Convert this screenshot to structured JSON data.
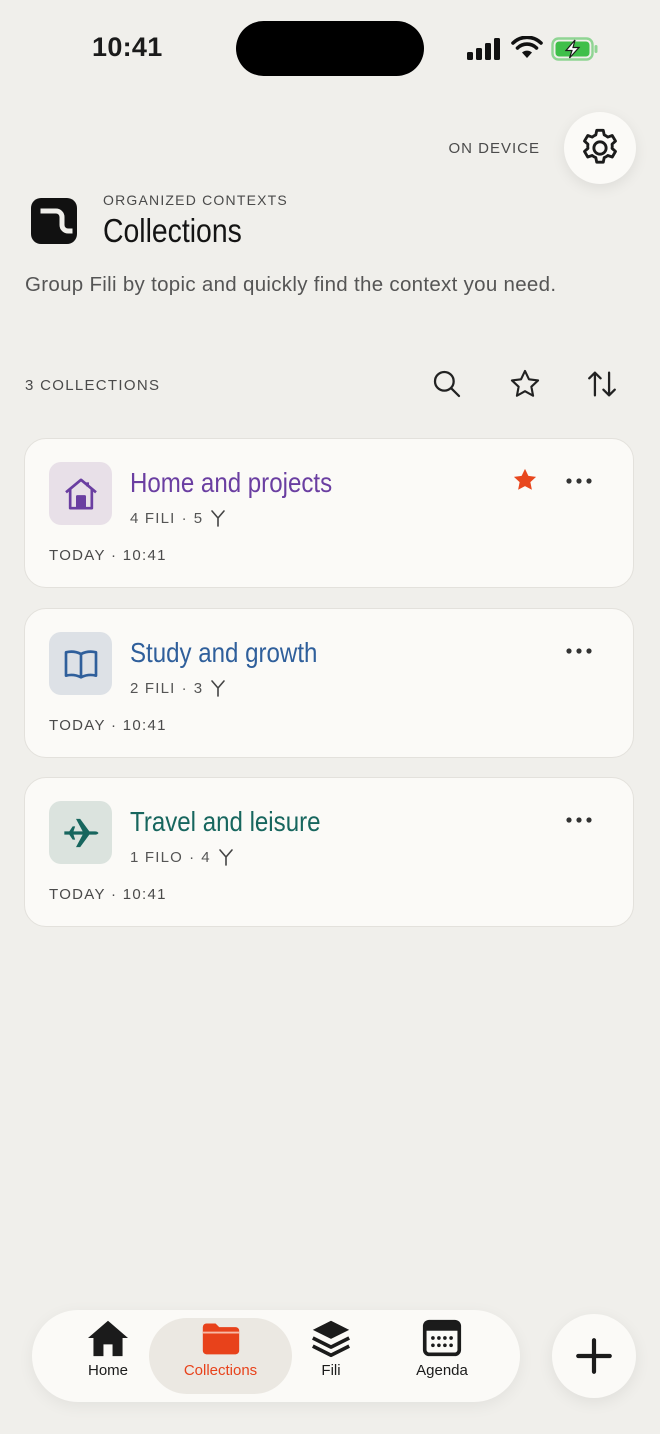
{
  "status_bar": {
    "time": "10:41"
  },
  "header": {
    "storage_label": "ON DEVICE",
    "eyebrow": "ORGANIZED CONTEXTS",
    "title": "Collections",
    "subtitle": "Group Fili by topic and quickly find the context you need."
  },
  "toolbar": {
    "count_label": "3 COLLECTIONS"
  },
  "collections": [
    {
      "title": "Home and projects",
      "meta_fili": "4 FILI",
      "meta_sep": "·",
      "meta_branches": "5",
      "date": "TODAY · 10:41",
      "starred": true,
      "icon": "house-icon",
      "accent": "#6a3ea1",
      "icon_bg": "#e8e0e8"
    },
    {
      "title": "Study and growth",
      "meta_fili": "2 FILI",
      "meta_sep": "·",
      "meta_branches": "3",
      "date": "TODAY · 10:41",
      "starred": false,
      "icon": "book-icon",
      "accent": "#2f5f9b",
      "icon_bg": "#dde1e6"
    },
    {
      "title": "Travel and leisure",
      "meta_fili": "1 FILO",
      "meta_sep": "·",
      "meta_branches": "4",
      "date": "TODAY · 10:41",
      "starred": false,
      "icon": "airplane-icon",
      "accent": "#17665e",
      "icon_bg": "#dbe3de"
    }
  ],
  "nav": {
    "items": [
      {
        "label": "Home",
        "icon": "home-icon"
      },
      {
        "label": "Collections",
        "icon": "folder-icon"
      },
      {
        "label": "Fili",
        "icon": "layers-icon"
      },
      {
        "label": "Agenda",
        "icon": "calendar-icon"
      }
    ],
    "active_color": "#e8421b"
  },
  "colors": {
    "background": "#f0efeb",
    "card": "#fbfaf7",
    "star": "#e8471e",
    "battery": "#3fbf4a"
  }
}
